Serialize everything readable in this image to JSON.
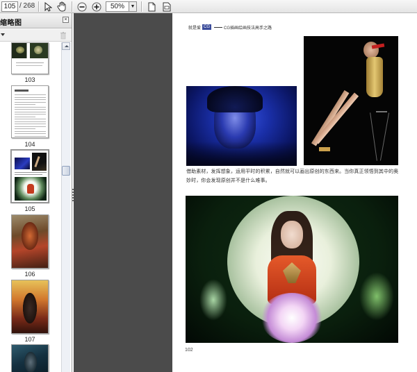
{
  "toolbar": {
    "current_page": "105",
    "total_pages": "/ 268",
    "zoom": "50%",
    "icons": [
      "select-arrow-icon",
      "hand-icon",
      "zoom-out-icon",
      "zoom-in-icon",
      "zoom-dropdown-icon",
      "fit-page-icon",
      "fit-width-icon"
    ]
  },
  "sidebar": {
    "title": "缩略图",
    "thumbnails": [
      {
        "page": "103"
      },
      {
        "page": "104"
      },
      {
        "page": "105"
      },
      {
        "page": "106"
      },
      {
        "page": "107"
      }
    ]
  },
  "document": {
    "header_left": "就是爱",
    "header_tag": "CG",
    "header_right": "CG插画绘画技法高手之路",
    "paragraph": "借助素材，发挥想象，运用平时的积累，自然就可以画出原创的东西来。当你真正领悟到其中的奥妙时，你会发现原创并不是什么难事。",
    "page_number": "102"
  }
}
